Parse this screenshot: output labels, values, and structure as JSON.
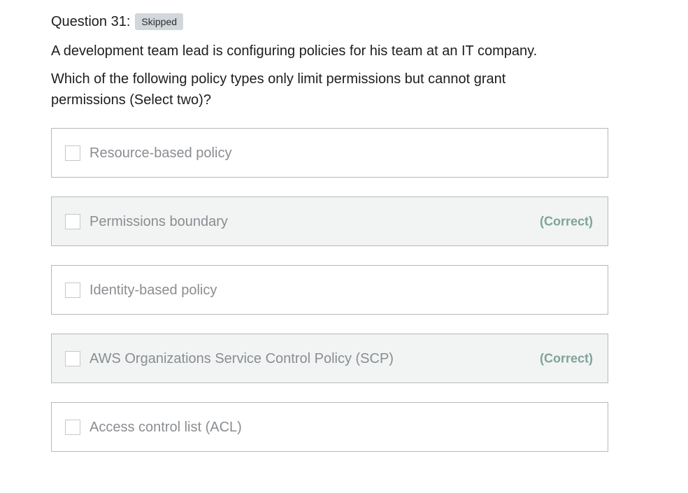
{
  "question": {
    "title": "Question 31:",
    "status_badge": "Skipped",
    "text_line1": "A development team lead is configuring policies for his team at an IT company.",
    "text_line2": "Which of the following policy types only limit permissions but cannot grant permissions (Select two)?"
  },
  "options": [
    {
      "label": "Resource-based policy",
      "tag": "",
      "correct": false
    },
    {
      "label": "Permissions boundary",
      "tag": "(Correct)",
      "correct": true
    },
    {
      "label": "Identity-based policy",
      "tag": "",
      "correct": false
    },
    {
      "label": "AWS Organizations Service Control Policy (SCP)",
      "tag": "(Correct)",
      "correct": true
    },
    {
      "label": "Access control list (ACL)",
      "tag": "",
      "correct": false
    }
  ]
}
